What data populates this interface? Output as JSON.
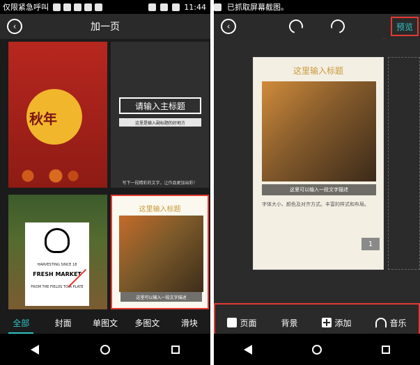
{
  "left": {
    "status": {
      "emergency_text": "仅限紧急呼叫",
      "time": "11:44"
    },
    "header": {
      "title": "加一页"
    },
    "templates": [
      {
        "caption": ""
      },
      {
        "main_title": "请输入主标题",
        "subtitle": "这里是输入副标题的好地方",
        "footer": "写下一段精彩的文字，让作品更加出彩！"
      },
      {
        "line_top": "HARVESTING SINCE 18",
        "line_main": "FRESH MARKET",
        "line_bottom": "FROM THE FIELDS TO A PLATE"
      },
      {
        "title": "这里输入标题",
        "caption": "这里可以输入一段文字描述"
      }
    ],
    "tabs": [
      {
        "label": "全部"
      },
      {
        "label": "封面"
      },
      {
        "label": "单图文"
      },
      {
        "label": "多图文"
      },
      {
        "label": "滑块"
      }
    ],
    "red_poster_text": "秋年"
  },
  "right": {
    "status": {
      "notification": "已抓取屏幕截图。"
    },
    "toolbar": {
      "preview_label": "预览"
    },
    "page_preview": {
      "title": "这里输入标题",
      "caption": "这里可以输入一段文字描述",
      "body": "字体大小、颜色及对齐方式。丰富的样式和布局。",
      "page_number": "1"
    },
    "bottom_tools": [
      {
        "label": "页面",
        "icon": "page-icon"
      },
      {
        "label": "背景",
        "icon": "grid-icon"
      },
      {
        "label": "添加",
        "icon": "plus-icon"
      },
      {
        "label": "音乐",
        "icon": "headphones-icon"
      }
    ]
  },
  "colors": {
    "accent": "#2ec4c4",
    "highlight": "#e53935"
  }
}
